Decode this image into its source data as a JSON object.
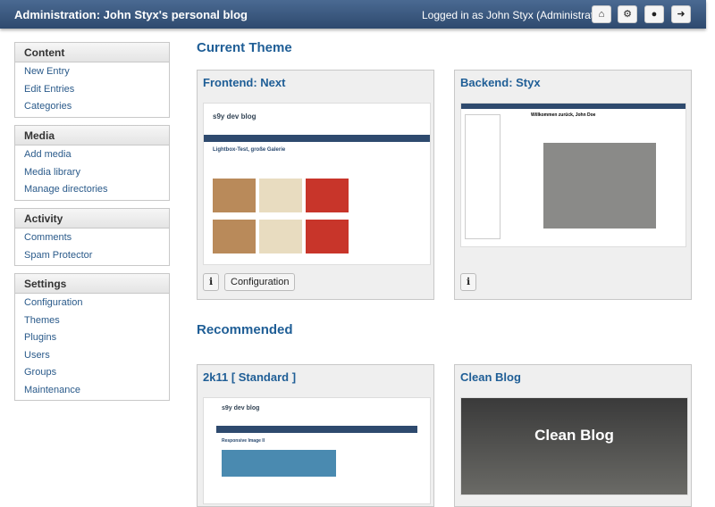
{
  "header": {
    "title": "Administration: John Styx's personal blog",
    "logged_in": "Logged in as John Styx (Administrator)",
    "icons": [
      "home-icon",
      "settings-icon",
      "globe-icon",
      "logout-icon"
    ]
  },
  "sidebar": [
    {
      "title": "Content",
      "items": [
        "New Entry",
        "Edit Entries",
        "Categories"
      ]
    },
    {
      "title": "Media",
      "items": [
        "Add media",
        "Media library",
        "Manage directories"
      ]
    },
    {
      "title": "Activity",
      "items": [
        "Comments",
        "Spam Protector"
      ]
    },
    {
      "title": "Settings",
      "items": [
        "Configuration",
        "Themes",
        "Plugins",
        "Users",
        "Groups",
        "Maintenance"
      ]
    }
  ],
  "main": {
    "current_heading": "Current Theme",
    "frontend": {
      "title": "Frontend: Next",
      "blog_title": "s9y dev blog",
      "post_title": "Lightbox-Test, große Galerie",
      "config_label": "Configuration"
    },
    "backend": {
      "title": "Backend: Styx",
      "welcome": "Willkommen zurück, John Doe"
    },
    "recommended_heading": "Recommended",
    "recommended": [
      {
        "title": "2k11 [ Standard ]",
        "blog_title": "s9y dev blog",
        "post_title": "Responsive Image II"
      },
      {
        "title": "Clean Blog",
        "hero": "Clean Blog"
      }
    ]
  }
}
